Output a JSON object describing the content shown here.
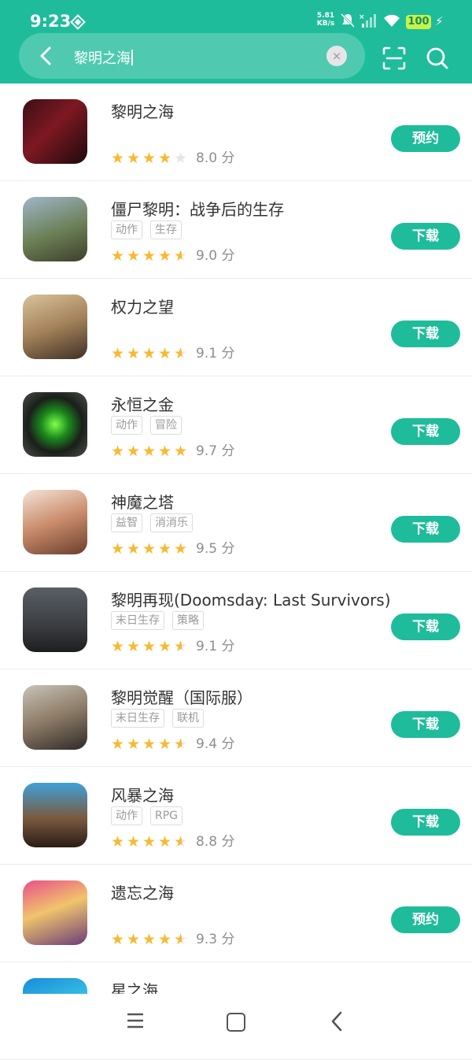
{
  "status_bar": {
    "time": "9:23",
    "net_speed_value": "5.81",
    "net_speed_unit": "KB/s",
    "battery": "100"
  },
  "search": {
    "query": "黎明之海",
    "clear_label": "×"
  },
  "colors": {
    "brand": "#1ebc9b",
    "star": "#f8b931",
    "star_empty": "#e6e6e6"
  },
  "results": [
    {
      "name": "黎明之海",
      "tags": [],
      "rating": 4.0,
      "score": "8.0 分",
      "action": "预约",
      "icon": "hooded-pirate-icon"
    },
    {
      "name": "僵尸黎明：战争后的生存",
      "tags": [
        "动作",
        "生存"
      ],
      "rating": 4.5,
      "score": "9.0 分",
      "action": "下载",
      "icon": "gasmask-soldier-icon"
    },
    {
      "name": "权力之望",
      "tags": [],
      "rating": 4.5,
      "score": "9.1 分",
      "action": "下载",
      "icon": "blonde-warrior-icon"
    },
    {
      "name": "永恒之金",
      "tags": [
        "动作",
        "冒险"
      ],
      "rating": 5,
      "score": "9.7 分",
      "action": "下载",
      "icon": "glowing-e-emblem-icon"
    },
    {
      "name": "神魔之塔",
      "tags": [
        "益智",
        "消消乐"
      ],
      "rating": 5,
      "score": "9.5 分",
      "action": "下载",
      "icon": "anime-girl-icon"
    },
    {
      "name": "黎明再现(Doomsday: Last Survivors)",
      "tags": [
        "末日生存",
        "策略"
      ],
      "rating": 4.5,
      "score": "9.1 分",
      "action": "下载",
      "icon": "doomsday-soldiers-icon"
    },
    {
      "name": "黎明觉醒（国际服）",
      "tags": [
        "末日生存",
        "联机"
      ],
      "rating": 4.5,
      "score": "9.4 分",
      "action": "下载",
      "icon": "cowboy-survivor-icon"
    },
    {
      "name": "风暴之海",
      "tags": [
        "动作",
        "RPG"
      ],
      "rating": 4.5,
      "score": "8.8 分",
      "action": "下载",
      "icon": "pirate-captain-icon"
    },
    {
      "name": "遗忘之海",
      "tags": [],
      "rating": 4.5,
      "score": "9.3 分",
      "action": "预约",
      "icon": "blonde-girl-icon"
    },
    {
      "name": "星之海",
      "tags": [],
      "rating": 0,
      "score": "",
      "action": "",
      "icon": "star-sea-icon"
    }
  ]
}
